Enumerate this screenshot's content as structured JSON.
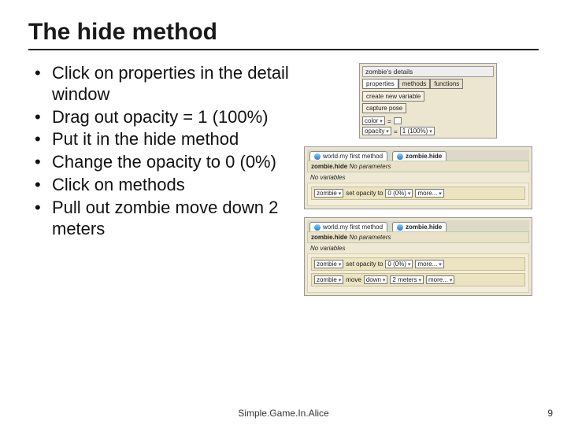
{
  "title": "The hide method",
  "bullets": [
    "Click on properties in the detail window",
    "Drag out opacity = 1 (100%)",
    "Put it in the hide method",
    "Change the opacity to 0 (0%)",
    "Click on methods",
    "Pull out zombie move down 2 meters"
  ],
  "details_panel": {
    "header": "zombie's details",
    "tabs": [
      "properties",
      "methods",
      "functions"
    ],
    "active_tab": 0,
    "create_var": "create new variable",
    "capture_pose": "capture pose",
    "color_label": "color",
    "color_eq": "=",
    "opacity_label": "opacity",
    "opacity_eq": "=",
    "opacity_val": "1 (100%)"
  },
  "method_panel_a": {
    "tab_world": "world.my first method",
    "tab_hide": "zombie.hide",
    "head_target": "zombie.hide",
    "head_rest": "No parameters",
    "sub": "No variables",
    "stmt1": {
      "obj": "zombie",
      "action": "set opacity to",
      "val": "0 (0%)",
      "more": "more..."
    }
  },
  "method_panel_b": {
    "tab_world": "world.my first method",
    "tab_hide": "zombie.hide",
    "head_target": "zombie.hide",
    "head_rest": "No parameters",
    "sub": "No variables",
    "stmt1": {
      "obj": "zombie",
      "action": "set opacity to",
      "val": "0 (0%)",
      "more": "more..."
    },
    "stmt2": {
      "obj": "zombie",
      "action": "move",
      "dir": "down",
      "amt": "2 meters",
      "more": "more..."
    }
  },
  "footer": "Simple.Game.In.Alice",
  "page": "9"
}
